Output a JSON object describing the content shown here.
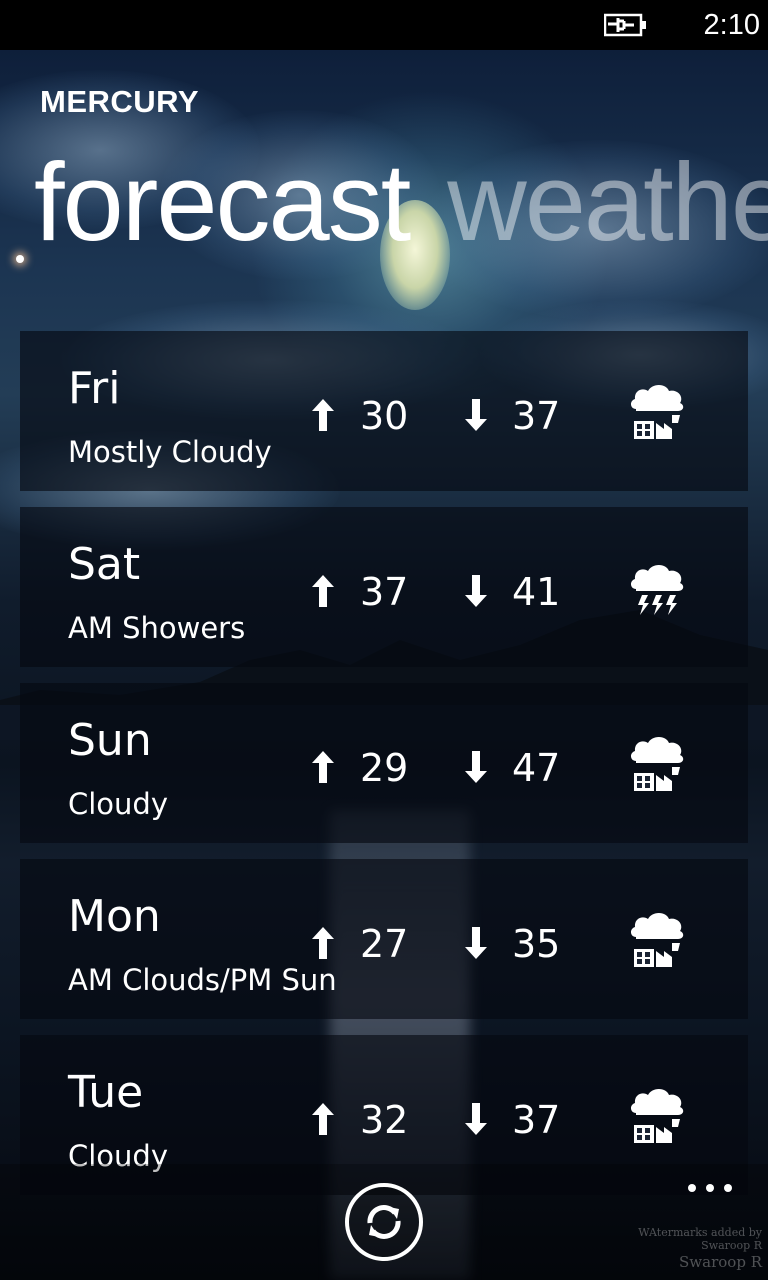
{
  "status_bar": {
    "time": "2:10",
    "battery_icon": "battery-charging-icon"
  },
  "app": {
    "title": "MERCURY"
  },
  "pivot": {
    "active": "forecast",
    "next": "weather"
  },
  "forecast": [
    {
      "day": "Fri",
      "condition": "Mostly Cloudy",
      "high": "30",
      "low": "37",
      "icon": "cloudy-icon"
    },
    {
      "day": "Sat",
      "condition": "AM Showers",
      "high": "37",
      "low": "41",
      "icon": "thunderstorm-icon"
    },
    {
      "day": "Sun",
      "condition": "Cloudy",
      "high": "29",
      "low": "47",
      "icon": "cloudy-icon"
    },
    {
      "day": "Mon",
      "condition": "AM Clouds/PM Sun",
      "high": "27",
      "low": "35",
      "icon": "cloudy-icon"
    },
    {
      "day": "Tue",
      "condition": "Cloudy",
      "high": "32",
      "low": "37",
      "icon": "cloudy-icon"
    }
  ],
  "app_bar": {
    "refresh_icon": "refresh-icon",
    "more_icon": "more-icon"
  },
  "watermark": {
    "line1": "WAtermarks added by Swaroop R",
    "line2": "Swaroop R"
  }
}
